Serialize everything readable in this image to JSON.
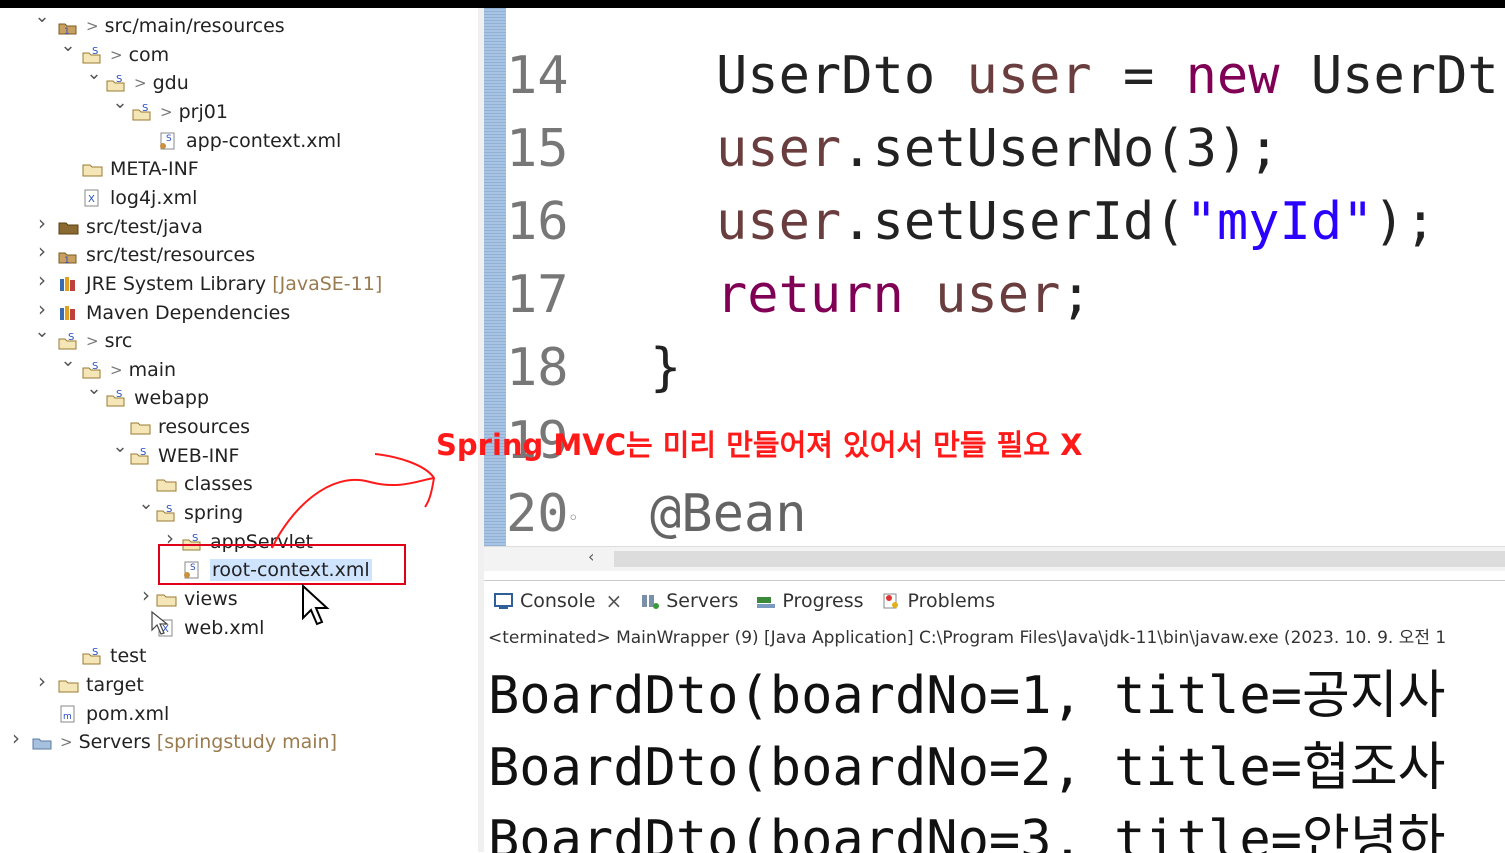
{
  "explorer": {
    "items": [
      {
        "label": "src/main/resources",
        "prefix": ">",
        "chev": "v"
      },
      {
        "label": "com",
        "prefix": ">",
        "chev": "v"
      },
      {
        "label": "gdu",
        "prefix": ">",
        "chev": "v"
      },
      {
        "label": "prj01",
        "prefix": ">",
        "chev": "v"
      },
      {
        "label": "app-context.xml"
      },
      {
        "label": "META-INF"
      },
      {
        "label": "log4j.xml"
      },
      {
        "label": "src/test/java",
        "chev": ">"
      },
      {
        "label": "src/test/resources",
        "chev": ">"
      },
      {
        "label": "JRE System Library",
        "suffix": "[JavaSE-11]",
        "chev": ">"
      },
      {
        "label": "Maven Dependencies",
        "chev": ">"
      },
      {
        "label": "src",
        "prefix": ">",
        "chev": "v"
      },
      {
        "label": "main",
        "prefix": ">",
        "chev": "v"
      },
      {
        "label": "webapp",
        "chev": "v"
      },
      {
        "label": "resources"
      },
      {
        "label": "WEB-INF",
        "chev": "v"
      },
      {
        "label": "classes"
      },
      {
        "label": "spring",
        "chev": "v"
      },
      {
        "label": "appServlet",
        "chev": ">"
      },
      {
        "label": "root-context.xml"
      },
      {
        "label": "views",
        "chev": ">"
      },
      {
        "label": "web.xml"
      },
      {
        "label": "test"
      },
      {
        "label": "target",
        "chev": ">"
      },
      {
        "label": "pom.xml"
      },
      {
        "label": "Servers",
        "prefix": ">",
        "suffix": "[springstudy main]",
        "chev": ">"
      }
    ]
  },
  "editor": {
    "lines": [
      {
        "num": "14",
        "parts": [
          [
            "",
            "UserDto "
          ],
          [
            "var",
            "user"
          ],
          [
            "",
            " = "
          ],
          [
            "kw",
            "new"
          ],
          [
            "",
            " UserDt"
          ]
        ]
      },
      {
        "num": "15",
        "parts": [
          [
            "var",
            "user"
          ],
          [
            "",
            ".setUserNo(3);"
          ]
        ]
      },
      {
        "num": "16",
        "parts": [
          [
            "var",
            "user"
          ],
          [
            "",
            ".setUserId("
          ],
          [
            "str",
            "\"myId\""
          ],
          [
            "",
            ");"
          ]
        ]
      },
      {
        "num": "17",
        "parts": [
          [
            "kw",
            "return"
          ],
          [
            "",
            " "
          ],
          [
            "var",
            "user"
          ],
          [
            "",
            ";"
          ]
        ]
      },
      {
        "num": "18",
        "parts": [
          [
            "",
            "}"
          ]
        ]
      },
      {
        "num": "19",
        "parts": []
      },
      {
        "num": "20",
        "marker": "◦",
        "parts": [
          [
            "ann",
            "@Bean"
          ]
        ]
      }
    ]
  },
  "annotation_note": "Spring MVC는 미리 만들어져 있어서 만들 필요 X",
  "console": {
    "tabs": [
      {
        "label": "Console",
        "close": "×"
      },
      {
        "label": "Servers"
      },
      {
        "label": "Progress"
      },
      {
        "label": "Problems"
      }
    ],
    "terminated": "<terminated> MainWrapper (9) [Java Application] C:\\Program Files\\Java\\jdk-11\\bin\\javaw.exe  (2023. 10. 9. 오전 1",
    "output": [
      "BoardDto(boardNo=1, title=공지사",
      "BoardDto(boardNo=2, title=협조사",
      "BoardDto(boardNo=3, title=안녕하"
    ]
  },
  "colors": {
    "keyword": "#7f0055",
    "variable": "#6a3e3e",
    "string": "#2a00ff",
    "annotation_red": "#ff1a1a"
  }
}
